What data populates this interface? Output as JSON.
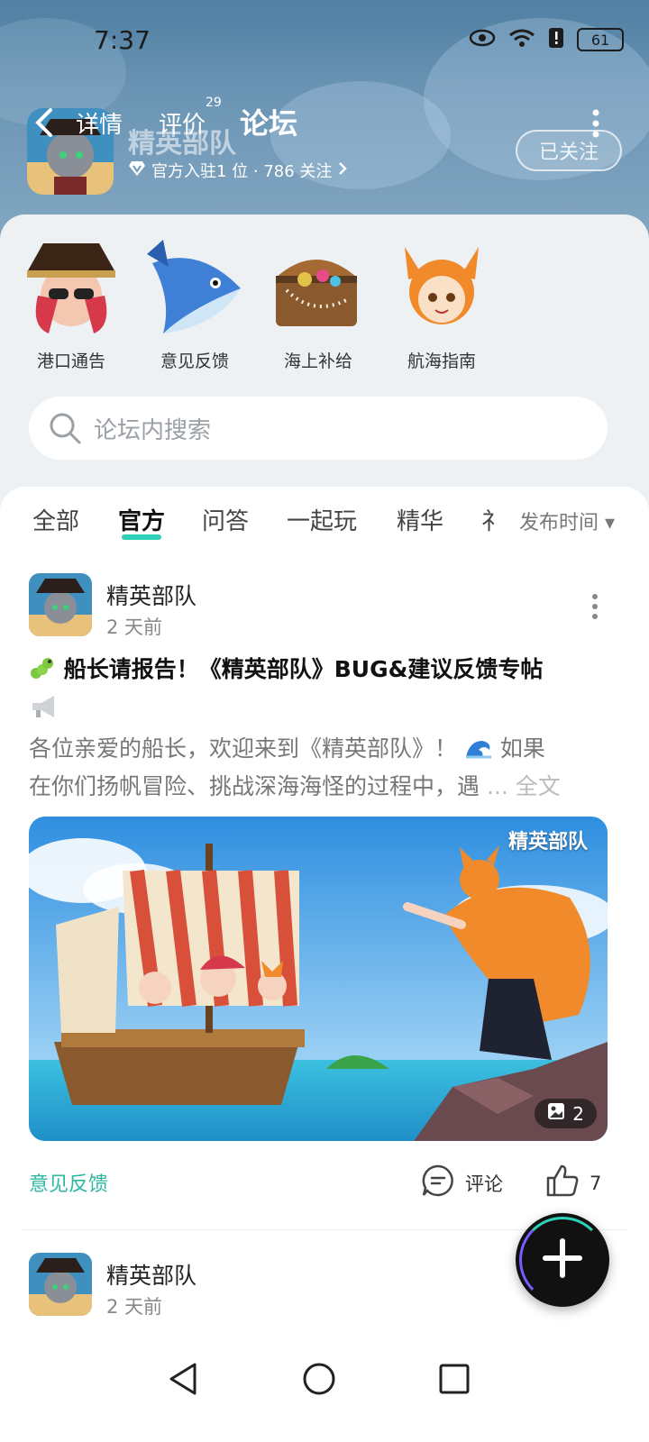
{
  "status_bar": {
    "time": "7:37",
    "battery": "61"
  },
  "header": {
    "tabs": [
      {
        "label": "详情"
      },
      {
        "label": "评价",
        "badge": "29"
      },
      {
        "label": "论坛"
      }
    ],
    "app_name": "精英部队",
    "meta": "官方入驻1 位 · 786 关注",
    "follow_label": "已关注"
  },
  "boards": [
    {
      "label": "港口通告"
    },
    {
      "label": "意见反馈"
    },
    {
      "label": "海上补给"
    },
    {
      "label": "航海指南"
    }
  ],
  "search": {
    "placeholder": "论坛内搜索"
  },
  "filters": {
    "tabs": [
      "全部",
      "官方",
      "问答",
      "一起玩",
      "精华",
      "礻"
    ],
    "sort_label": "发布时间"
  },
  "posts": [
    {
      "author": "精英部队",
      "time": "2 天前",
      "title": "船长请报告！《精英部队》BUG&建议反馈专帖",
      "excerpt_line1": "各位亲爱的船长，欢迎来到《精英部队》！",
      "excerpt_line1_tail": "如果",
      "excerpt_line2": "在你们扬帆冒险、挑战深海海怪的过程中，遇",
      "more_label": "... 全文",
      "image_watermark": "精英部队",
      "image_count": "2",
      "tag": "意见反馈",
      "comment_label": "评论",
      "like_count": "7"
    },
    {
      "author": "精英部队",
      "time": "2 天前"
    }
  ],
  "colors": {
    "accent": "#2fd0b8",
    "tag": "#2fb7a2",
    "header": "#6b94b4"
  }
}
